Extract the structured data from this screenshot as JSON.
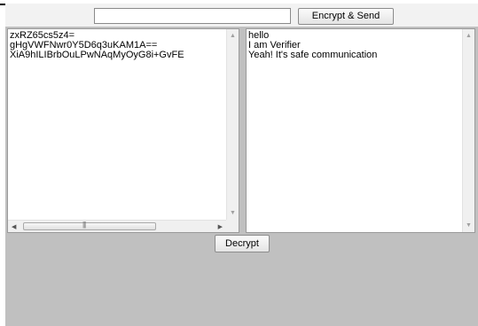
{
  "sender": {
    "message_input_value": "",
    "encrypt_send_label": "Encrypt & Send",
    "ciphertext": "zxRZ65cs5z4=\ngHgVWFNwr0Y5D6q3uKAM1A==\nXiA9hILIBrbOuLPwNAqMyOyG8i+GvFE"
  },
  "verifier": {
    "plaintext": "hello\nI am Verifier\nYeah! It's safe communication"
  },
  "decrypt_label": "Decrypt",
  "icons": {
    "scroll_up": "▲",
    "scroll_down": "▼",
    "scroll_left": "◀",
    "scroll_right": "▶",
    "thumb_grip": "|||"
  }
}
